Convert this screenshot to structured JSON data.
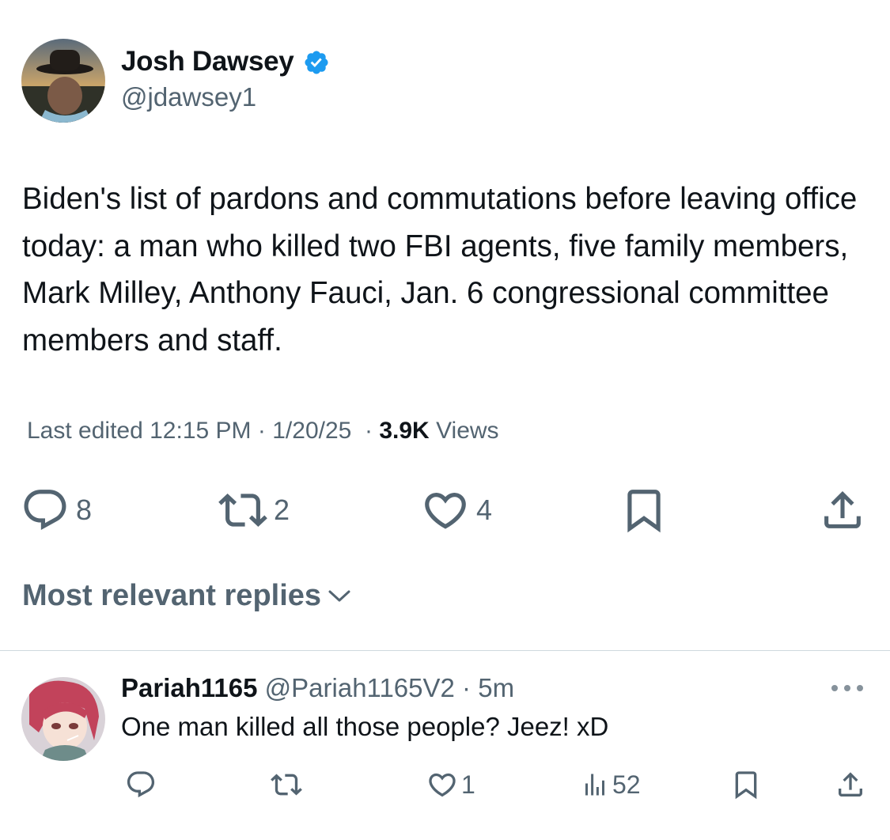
{
  "tweet": {
    "author_name": "Josh Dawsey",
    "author_handle": "@jdawsey1",
    "verified": true,
    "text": "Biden's list of pardons and commutations before leaving office today: a man who killed two FBI agents, five family members, Mark Milley, Anthony Fauci, Jan. 6 congressional committee members and staff.",
    "edited_label": "Last edited",
    "time": "12:15 PM",
    "date": "1/20/25",
    "views_count": "3.9K",
    "views_label": "Views",
    "replies": "8",
    "retweets": "2",
    "likes": "4"
  },
  "replies_section": {
    "sort_label": "Most relevant replies"
  },
  "reply": {
    "name": "Pariah1165",
    "handle": "@Pariah1165V2",
    "time": "5m",
    "text": "One man killed all those people? Jeez! xD",
    "likes": "1",
    "views": "52"
  },
  "colors": {
    "verified_blue": "#1d9bf0",
    "muted_text": "#536471",
    "primary_text": "#0f1419"
  },
  "icons": [
    "verified-badge-icon",
    "reply-icon",
    "retweet-icon",
    "like-icon",
    "bookmark-icon",
    "share-icon",
    "chevron-down-icon",
    "more-icon",
    "views-icon"
  ]
}
